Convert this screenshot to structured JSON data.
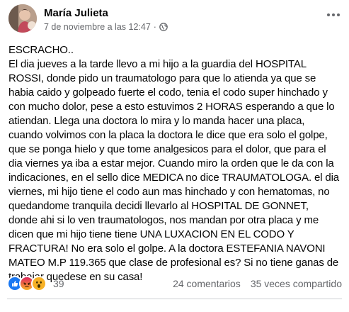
{
  "post": {
    "author": "María Julieta",
    "date": "7 de noviembre a las 12:47",
    "separator": "·",
    "privacy_icon": "globe-icon",
    "more_icon": "more-options-icon",
    "text": "ESCRACHO..\n El dia jueves a la tarde llevo a mi hijo a la guardia del HOSPITAL\nROSSI, donde pido un traumatologo para que lo atienda ya que se\nhabia caido y golpeado fuerte el codo, tenia el codo super hinchado y\ncon mucho dolor, pese a esto estuvimos 2 HORAS esperando a que lo\natiendan. Llega una doctora lo mira y lo manda hacer una placa,\ncuando volvimos con la placa la doctora le dice que era solo el golpe,\nque se ponga hielo y que tome analgesicos para el dolor, que para el\ndia viernes ya iba a estar mejor. Cuando miro la orden que le da con la\nindicaciones, en el sello dice MEDICA no dice TRAUMATOLOGA. el dia\nviernes, mi hijo tiene el codo aun mas hinchado y con hematomas, no\nquedandome tranquila decidi llevarlo al HOSPITAL DE GONNET,\ndonde ahi si lo ven traumatologos, nos mandan por otra placa y me\ndicen que mi hijo tiene tiene UNA LUXACION EN EL CODO Y\nFRACTURA! No era solo el golpe. A la doctora  ESTEFANIA NAVONI\nMATEO  M.P 119.365 que clase de profesional es? Si no tiene ganas de\ntrabajar quedese en su casa!"
  },
  "footer": {
    "reactions": [
      {
        "icon": "like-reaction-icon",
        "color": "#1877f2"
      },
      {
        "icon": "angry-reaction-icon",
        "color": "#e9710f"
      },
      {
        "icon": "wow-reaction-icon",
        "color": "#f7b125"
      }
    ],
    "reaction_count": "39",
    "comments": "24 comentarios",
    "shares": "35 veces compartido"
  },
  "colors": {
    "text": "#050505",
    "secondary": "#65676b",
    "divider": "#ced0d4"
  }
}
